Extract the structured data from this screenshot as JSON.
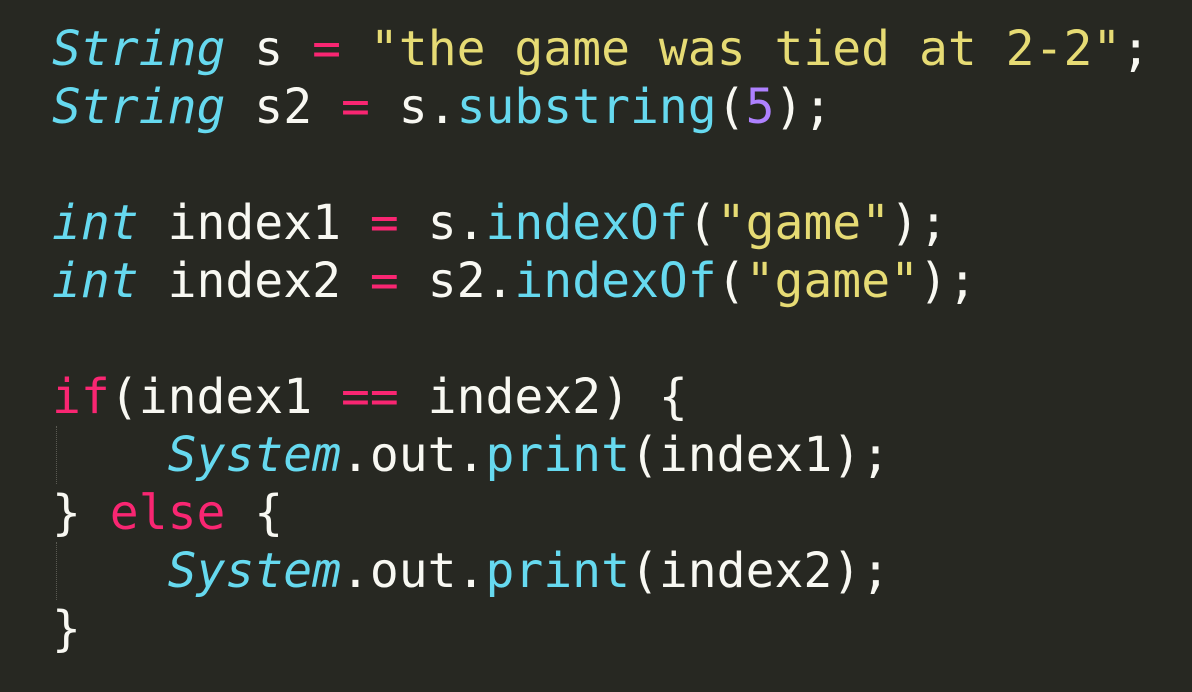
{
  "editor": {
    "theme_colors": {
      "background": "#272822",
      "foreground": "#f8f8f2",
      "type": "#66d9ef",
      "keyword": "#f92672",
      "string": "#e6db74",
      "number": "#ae81ff"
    },
    "lines": [
      [
        {
          "t": "String",
          "c": "type-italic"
        },
        {
          "t": " s ",
          "c": "plain"
        },
        {
          "t": "=",
          "c": "operator"
        },
        {
          "t": " ",
          "c": "plain"
        },
        {
          "t": "\"the game was tied at 2-2\"",
          "c": "string"
        },
        {
          "t": ";",
          "c": "plain"
        }
      ],
      [
        {
          "t": "String",
          "c": "type-italic"
        },
        {
          "t": " s2 ",
          "c": "plain"
        },
        {
          "t": "=",
          "c": "operator"
        },
        {
          "t": " s.",
          "c": "plain"
        },
        {
          "t": "substring",
          "c": "method"
        },
        {
          "t": "(",
          "c": "plain"
        },
        {
          "t": "5",
          "c": "number"
        },
        {
          "t": ");",
          "c": "plain"
        }
      ],
      [],
      [
        {
          "t": "int",
          "c": "type-italic"
        },
        {
          "t": " index1 ",
          "c": "plain"
        },
        {
          "t": "=",
          "c": "operator"
        },
        {
          "t": " s.",
          "c": "plain"
        },
        {
          "t": "indexOf",
          "c": "method"
        },
        {
          "t": "(",
          "c": "plain"
        },
        {
          "t": "\"game\"",
          "c": "string"
        },
        {
          "t": ");",
          "c": "plain"
        }
      ],
      [
        {
          "t": "int",
          "c": "type-italic"
        },
        {
          "t": " index2 ",
          "c": "plain"
        },
        {
          "t": "=",
          "c": "operator"
        },
        {
          "t": " s2.",
          "c": "plain"
        },
        {
          "t": "indexOf",
          "c": "method"
        },
        {
          "t": "(",
          "c": "plain"
        },
        {
          "t": "\"game\"",
          "c": "string"
        },
        {
          "t": ");",
          "c": "plain"
        }
      ],
      [],
      [
        {
          "t": "if",
          "c": "keyword"
        },
        {
          "t": "(index1 ",
          "c": "plain"
        },
        {
          "t": "==",
          "c": "operator"
        },
        {
          "t": " index2) {",
          "c": "plain"
        }
      ],
      [
        {
          "t": "    ",
          "c": "plain",
          "guide": true
        },
        {
          "t": "System",
          "c": "type-italic"
        },
        {
          "t": ".out.",
          "c": "plain"
        },
        {
          "t": "print",
          "c": "method"
        },
        {
          "t": "(index1);",
          "c": "plain"
        }
      ],
      [
        {
          "t": "} ",
          "c": "plain"
        },
        {
          "t": "else",
          "c": "keyword"
        },
        {
          "t": " {",
          "c": "plain"
        }
      ],
      [
        {
          "t": "    ",
          "c": "plain",
          "guide": true
        },
        {
          "t": "System",
          "c": "type-italic"
        },
        {
          "t": ".out.",
          "c": "plain"
        },
        {
          "t": "print",
          "c": "method"
        },
        {
          "t": "(index2);",
          "c": "plain"
        }
      ],
      [
        {
          "t": "}",
          "c": "plain"
        }
      ]
    ]
  }
}
